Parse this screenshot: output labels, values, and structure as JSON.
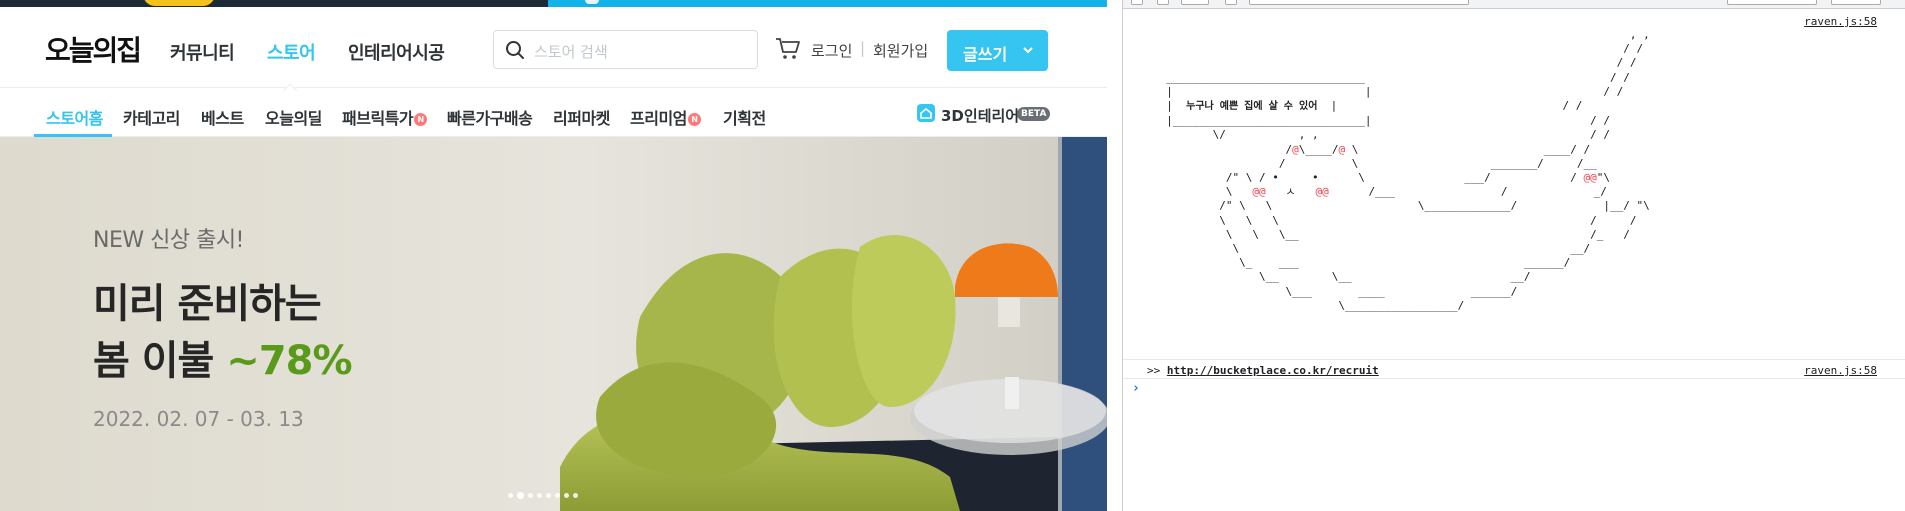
{
  "site": {
    "logo": "오늘의집",
    "gnb": [
      "커뮤니티",
      "스토어",
      "인테리어시공"
    ],
    "gnb_active": "스토어",
    "search_placeholder": "스토어 검색",
    "login": "로그인",
    "separator": "|",
    "signup": "회원가입",
    "write_button": "글쓰기",
    "lnb": [
      "스토어홈",
      "카테고리",
      "베스트",
      "오늘의딜",
      "패브릭특가",
      "빠른가구배송",
      "리퍼마켓",
      "프리미엄",
      "기획전"
    ],
    "new_badge": "N",
    "label_3d": "3D인테리어",
    "beta_badge": "BETA",
    "hero": {
      "kicker": "NEW 신상 출시!",
      "title_line1": "미리 준비하는",
      "title_line2": "봄 이불 ",
      "title_pct": "~78%",
      "date": "2022. 02. 07 - 03. 13",
      "slide_count": 8,
      "active_slide": 2
    }
  },
  "colors": {
    "accent": "#35c5f0",
    "hero_pct": "#5a9a1a",
    "new_badge": "#ff7777",
    "ascii_red": "#ff3d4a"
  },
  "devtools": {
    "source_link_1": "raven.js:58",
    "source_link_2": "raven.js:58",
    "bubble_text": "누구나 예쁜 집에 살 수 있어",
    "recruit_prefix": ">>",
    "recruit_url": "http://bucketplace.co.kr/recruit",
    "prompt_glyph": "›"
  },
  "icons": [
    "search-icon",
    "cart-icon",
    "chevron-down-icon",
    "3d-house-icon"
  ]
}
